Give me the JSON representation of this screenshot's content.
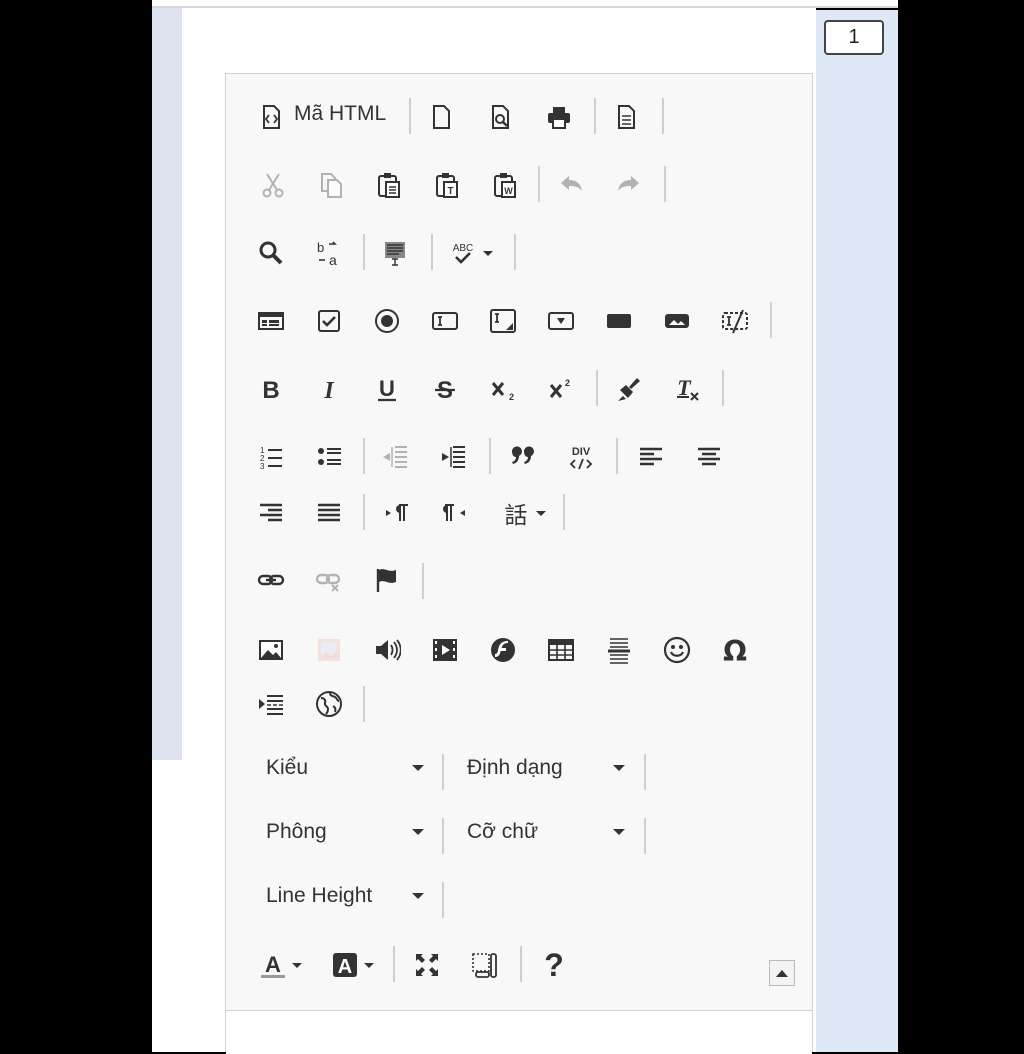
{
  "page": {
    "page_number": "1"
  },
  "toolbar": {
    "source_label": "Mã HTML",
    "styles_label": "Kiểu",
    "format_label": "Định dạng",
    "font_label": "Phông",
    "size_label": "Cỡ chữ",
    "line_height_label": "Line Height",
    "help_label": "?",
    "superscript_label": "2",
    "subscript_label": "2",
    "div_label": "DIV",
    "spell_label": "ABC"
  },
  "icons": {
    "color_main": "#333333",
    "color_disabled": "#b5b5b5"
  }
}
